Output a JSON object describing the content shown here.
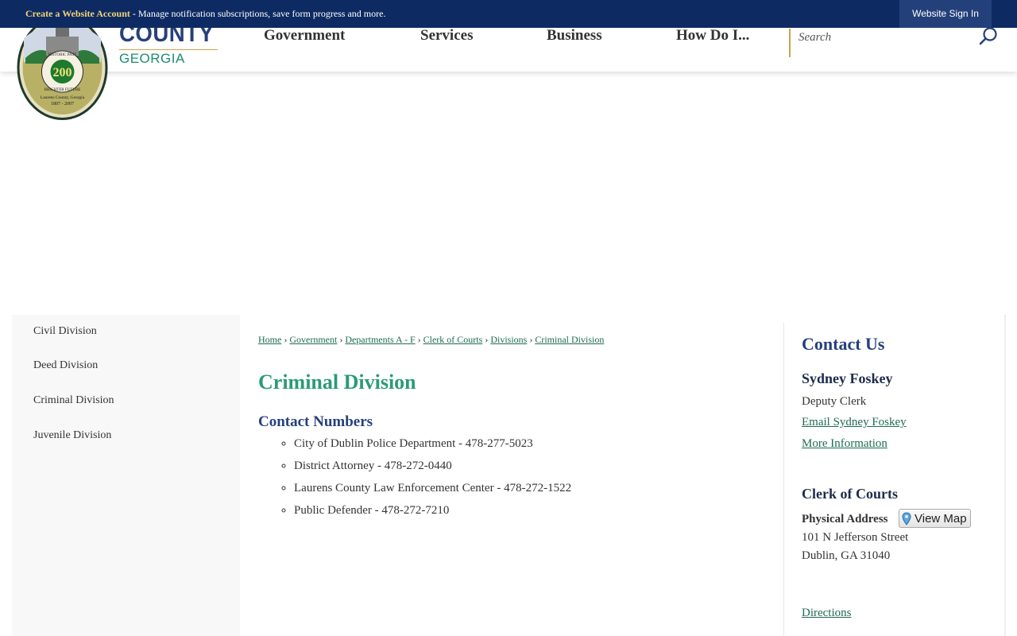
{
  "topbar": {
    "account_link": "Create a Website Account",
    "message": " - Manage notification subscriptions, save form progress and more.",
    "sign_in": "Website Sign In"
  },
  "header": {
    "seal_text": {
      "top_left": "HISTORIC PAST",
      "bottom": "BRIGHTER FUTURE",
      "number": "200",
      "county": "Laurens County, Georgia",
      "years": "1807 - 2007"
    },
    "brand_county": "COUNTY",
    "brand_state": "GEORGIA",
    "nav": [
      {
        "label": "Government"
      },
      {
        "label": "Services"
      },
      {
        "label": "Business"
      },
      {
        "label": "How Do I..."
      }
    ],
    "search_placeholder": "Search"
  },
  "sidebar": {
    "items": [
      {
        "label": "Civil Division"
      },
      {
        "label": "Deed Division"
      },
      {
        "label": "Criminal Division"
      },
      {
        "label": "Juvenile Division"
      }
    ]
  },
  "breadcrumb": {
    "items": [
      {
        "label": "Home"
      },
      {
        "label": "Government"
      },
      {
        "label": "Departments A - F"
      },
      {
        "label": "Clerk of Courts"
      },
      {
        "label": "Divisions"
      },
      {
        "label": "Criminal Division"
      }
    ],
    "separator": "›"
  },
  "main": {
    "title": "Criminal Division",
    "section_title": "Contact Numbers",
    "contacts": [
      {
        "text": "City of Dublin Police Department - 478-277-5023"
      },
      {
        "text": "District Attorney - 478-272-0440"
      },
      {
        "text": "Laurens County Law Enforcement Center - 478-272-1522"
      },
      {
        "text": "Public Defender - 478-272-7210"
      }
    ]
  },
  "contact_us": {
    "heading": "Contact Us",
    "person_name": "Sydney Foskey",
    "person_title": "Deputy Clerk",
    "email_link": "Email Sydney Foskey",
    "more_link": "More Information",
    "office_name": "Clerk of Courts",
    "address_label": "Physical Address",
    "map_button": "View Map",
    "address_line1": "101 N Jefferson Street",
    "address_line2": "Dublin, GA 31040",
    "directions_link": "Directions"
  },
  "colors": {
    "topbar_bg": "#0d2b62",
    "brand_blue": "#26407c",
    "brand_green": "#2a9b76",
    "accent_gold": "#c9a44a"
  }
}
